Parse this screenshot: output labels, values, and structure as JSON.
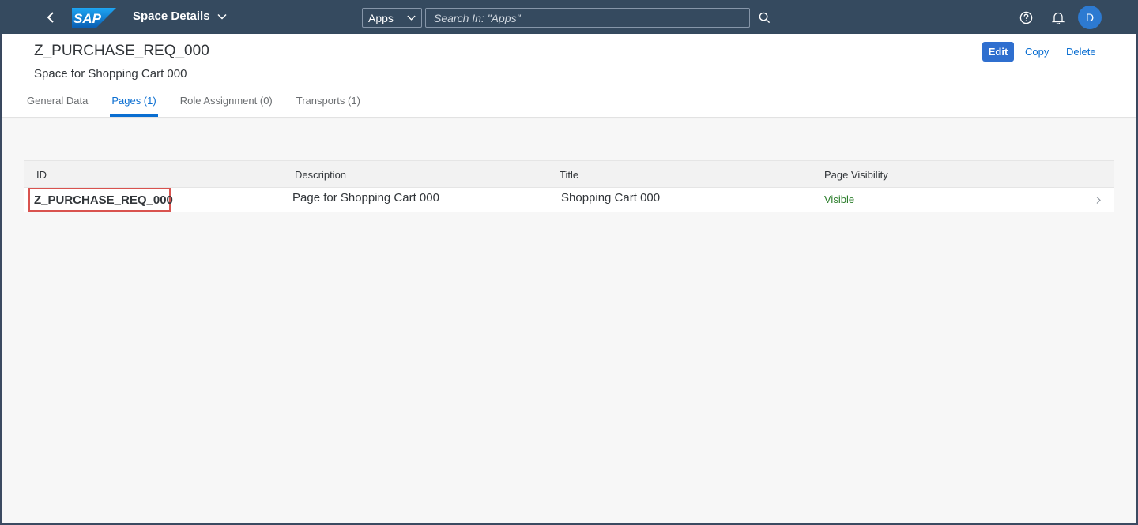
{
  "shell": {
    "logo_text": "SAP",
    "app_title": "Space Details",
    "search_scope": "Apps",
    "search_placeholder": "Search In: \"Apps\"",
    "avatar_initial": "D"
  },
  "header": {
    "title": "Z_PURCHASE_REQ_000",
    "subtitle": "Space for Shopping Cart 000",
    "actions": {
      "edit": "Edit",
      "copy": "Copy",
      "delete": "Delete"
    }
  },
  "tabs": [
    {
      "label": "General Data",
      "active": false
    },
    {
      "label": "Pages (1)",
      "active": true
    },
    {
      "label": "Role Assignment (0)",
      "active": false
    },
    {
      "label": "Transports (1)",
      "active": false
    }
  ],
  "table": {
    "columns": {
      "id": "ID",
      "description": "Description",
      "title": "Title",
      "visibility": "Page Visibility"
    },
    "rows": [
      {
        "id": "Z_PURCHASE_REQ_000",
        "description": "Page for Shopping Cart 000",
        "title": "Shopping Cart 000",
        "visibility": "Visible"
      }
    ]
  },
  "colors": {
    "shell_bg": "#354a5f",
    "accent": "#0a6ed1",
    "positive": "#2b7d2b",
    "highlight_border": "#d9534f"
  }
}
